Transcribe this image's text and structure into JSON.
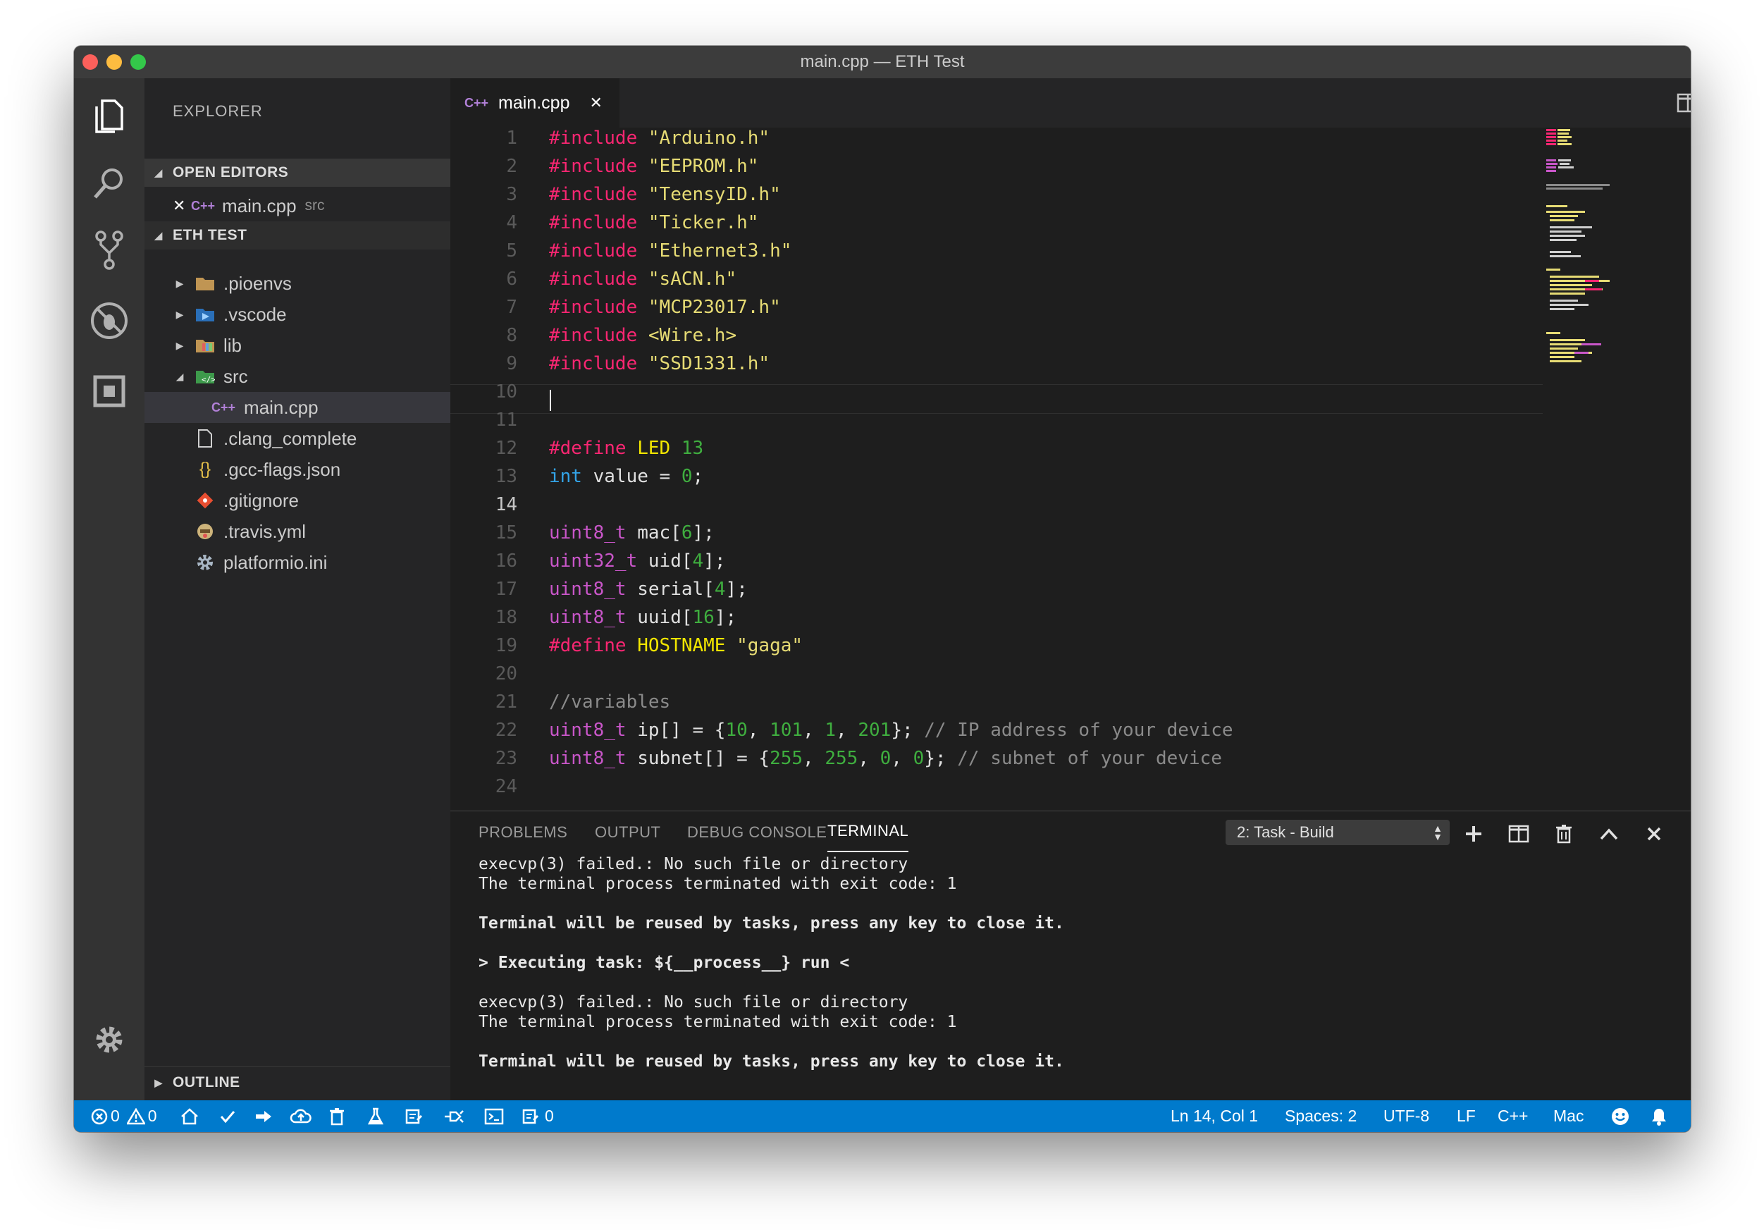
{
  "window": {
    "title": "main.cpp — ETH Test"
  },
  "sidebar": {
    "title": "EXPLORER",
    "open_editors_label": "OPEN EDITORS",
    "open_editor": {
      "name": "main.cpp",
      "folder": "src"
    },
    "project_label": "ETH TEST",
    "outline_label": "OUTLINE",
    "tree": [
      {
        "name": ".pioenvs",
        "icon": "folder-icon"
      },
      {
        "name": ".vscode",
        "icon": "vscode-folder-icon"
      },
      {
        "name": "lib",
        "icon": "lib-folder-icon"
      },
      {
        "name": "src",
        "icon": "src-folder-icon"
      },
      {
        "name": "main.cpp",
        "icon": "cpp-icon"
      },
      {
        "name": ".clang_complete",
        "icon": "file-icon"
      },
      {
        "name": ".gcc-flags.json",
        "icon": "json-icon"
      },
      {
        "name": ".gitignore",
        "icon": "git-icon"
      },
      {
        "name": ".travis.yml",
        "icon": "travis-icon"
      },
      {
        "name": "platformio.ini",
        "icon": "gear-icon"
      }
    ]
  },
  "editor": {
    "tab_label": "main.cpp",
    "cpp_badge": "C++",
    "current_line": 14,
    "line_numbers": [
      "1",
      "2",
      "3",
      "4",
      "5",
      "6",
      "7",
      "8",
      "9",
      "10",
      "11",
      "12",
      "13",
      "14",
      "15",
      "16",
      "17",
      "18",
      "19",
      "20",
      "21",
      "22",
      "23",
      "24"
    ],
    "code": {
      "inc": "#include",
      "l1": "\"Arduino.h\"",
      "l2": "\"EEPROM.h\"",
      "l3": "\"TeensyID.h\"",
      "l4": "\"Ticker.h\"",
      "l5": "\"Ethernet3.h\"",
      "l6": "\"sACN.h\"",
      "l7": "\"MCP23017.h\"",
      "l8": "<Wire.h>",
      "l9": "\"SSD1331.h\"",
      "def": "#define",
      "led": "LED",
      "led_val": "13",
      "int": "int",
      "value_eq": "value = ",
      "zero": "0",
      "semi": ";",
      "uint8": "uint8_t",
      "uint32": "uint32_t",
      "mac": "mac[",
      "six": "6",
      "uid": "uid[",
      "four": "4",
      "close": "];",
      "serial": "serial[",
      "uuid": "uuid[",
      "sixteen": "16",
      "hostname": "HOSTNAME",
      "hostval": "\"gaga\"",
      "varcomment": "//variables",
      "ip": "ip[] = {",
      "ip1": "10",
      "ip2": "101",
      "ip3": "1",
      "ip4": "201",
      "comma": ", ",
      "endarr": "};",
      "ipcomment": "// IP address of your device",
      "subnet": "subnet[] = {",
      "sn1": "255",
      "sn2": "255",
      "sn3": "0",
      "sn4": "0",
      "subcomment": "// subnet of your device"
    }
  },
  "panel": {
    "tabs": [
      "PROBLEMS",
      "OUTPUT",
      "DEBUG CONSOLE",
      "TERMINAL"
    ],
    "active_tab": "TERMINAL",
    "task_select": "2: Task - Build",
    "terminal": [
      "execvp(3) failed.: No such file or directory",
      "The terminal process terminated with exit code: 1",
      "Terminal will be reused by tasks, press any key to close it.",
      "> Executing task: ${__process__} run <",
      "execvp(3) failed.: No such file or directory",
      "The terminal process terminated with exit code: 1",
      "Terminal will be reused by tasks, press any key to close it."
    ]
  },
  "statusbar": {
    "errors": "0",
    "warnings": "0",
    "tasks_count": "0",
    "position": "Ln 14, Col 1",
    "spaces": "Spaces: 2",
    "encoding": "UTF-8",
    "eol": "LF",
    "language": "C++",
    "platform": "Mac"
  },
  "colors": {
    "accent": "#007acc",
    "include": "#f92672",
    "string": "#e6db74",
    "number": "#3fae3f",
    "type": "#c956c9"
  }
}
